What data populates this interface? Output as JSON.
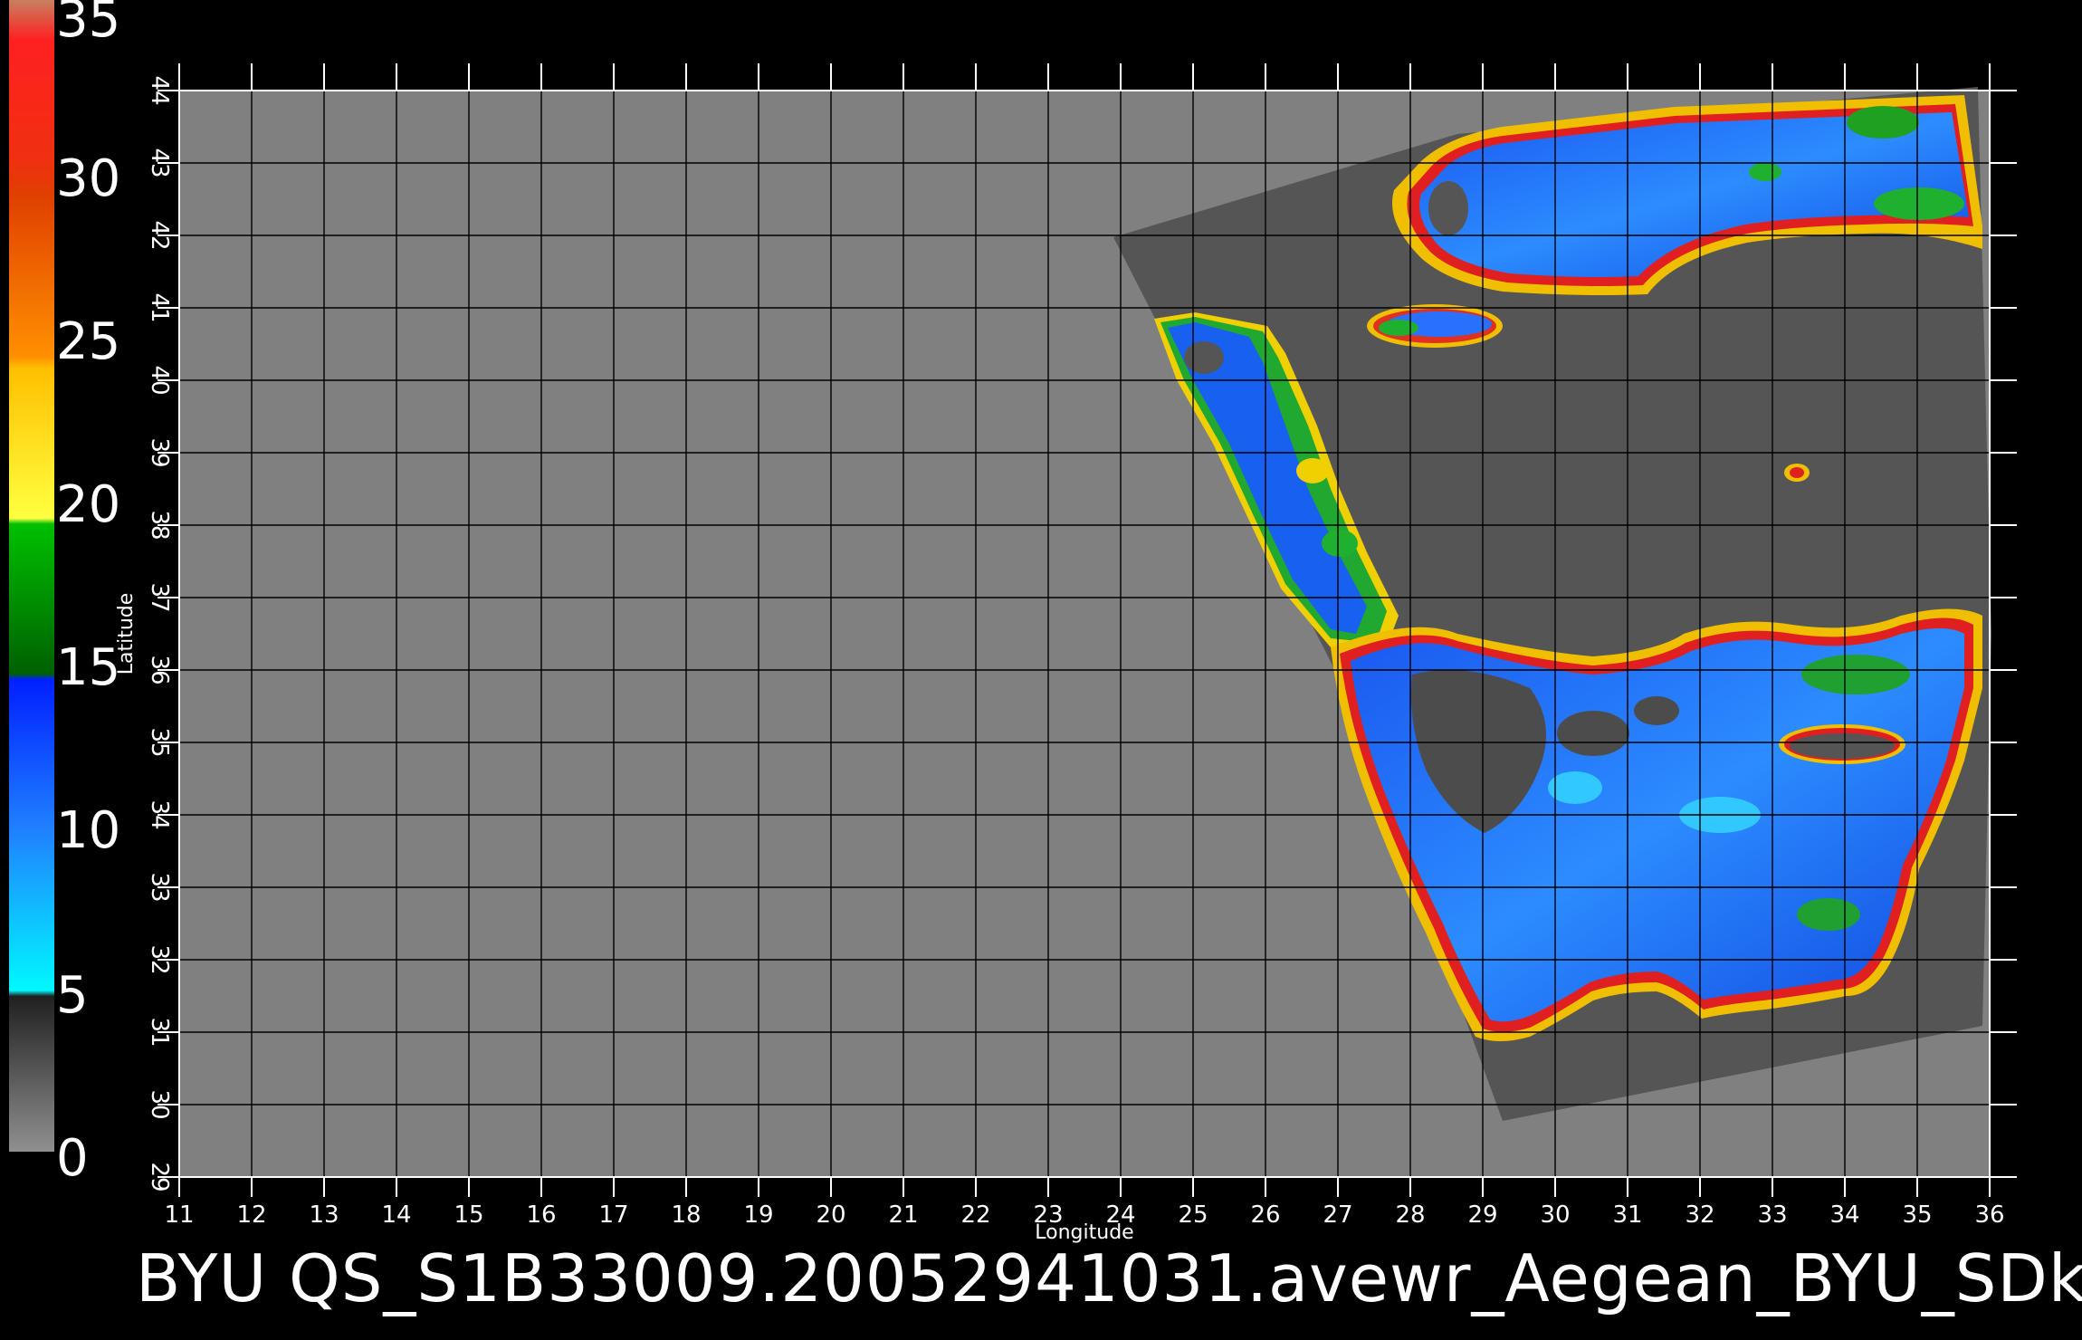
{
  "colorbar": {
    "labels": [
      "35",
      "30",
      "25",
      "20",
      "15",
      "10",
      "5",
      "0"
    ],
    "segments": [
      {
        "color": "#c08060"
      },
      {
        "color": "#ff2020"
      },
      {
        "color": "#e04010"
      },
      {
        "color": "#ffd000"
      },
      {
        "color": "#00b000"
      },
      {
        "color": "#1060ff"
      },
      {
        "color": "#00e8ff"
      },
      {
        "color": "#707070"
      }
    ]
  },
  "map": {
    "lon_ticks": [
      "11",
      "12",
      "13",
      "14",
      "15",
      "16",
      "17",
      "18",
      "19",
      "20",
      "21",
      "22",
      "23",
      "24",
      "25",
      "26",
      "27",
      "28",
      "29",
      "30",
      "31",
      "32",
      "33",
      "34",
      "35",
      "36"
    ],
    "lat_ticks": [
      "29",
      "30",
      "31",
      "32",
      "33",
      "34",
      "35",
      "36",
      "37",
      "38",
      "39",
      "40",
      "41",
      "42",
      "43",
      "44"
    ],
    "lon_range": [
      11,
      36
    ],
    "lat_range": [
      29,
      44
    ],
    "xlabel": "Longitude",
    "ylabel": "Latitude",
    "land_color": "#808080",
    "swath_color": "#555555"
  },
  "footer": {
    "title": "BYU  QS_S1B33009.20052941031.avewr_Aegean_BYU_SDk"
  }
}
